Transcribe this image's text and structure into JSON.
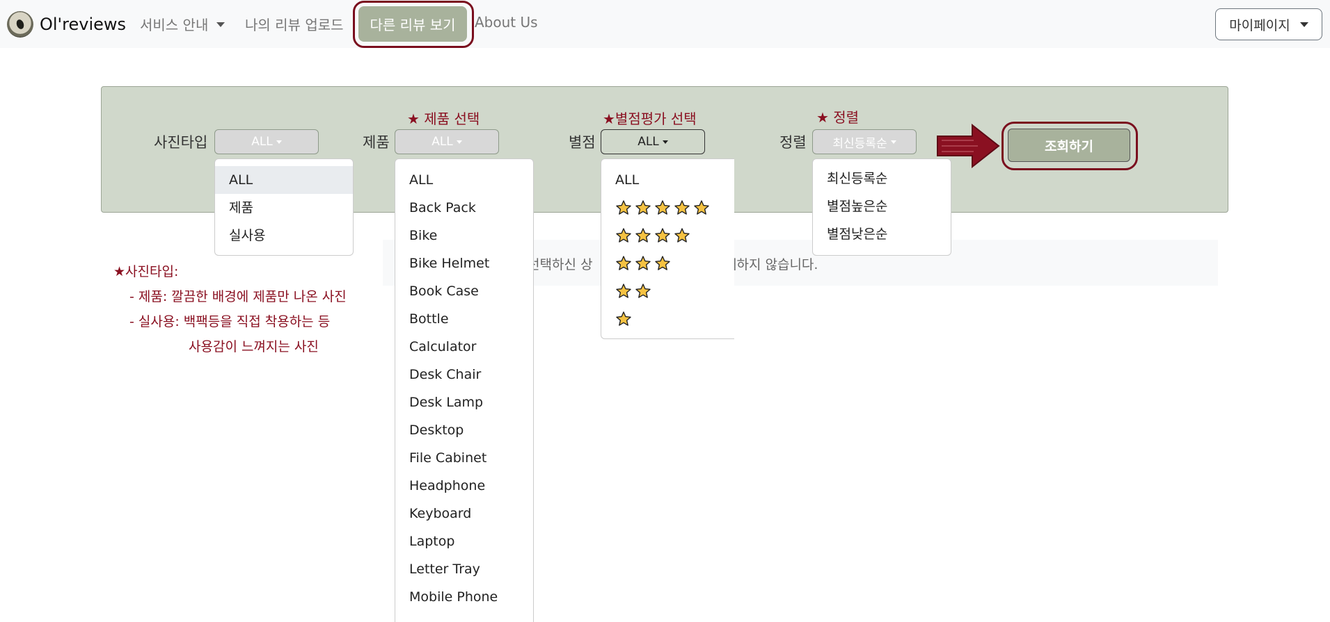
{
  "navbar": {
    "brand": "Ol'reviews",
    "service_guide": "서비스 안내",
    "upload_review": "나의 리뷰 업로드",
    "other_reviews": "다른 리뷰 보기",
    "about": "About Us",
    "mypage": "마이페이지"
  },
  "filters": {
    "photo_type_label": "사진타입",
    "product_label": "제품",
    "rating_label": "별점",
    "sort_label": "정렬",
    "photo_type_value": "ALL",
    "product_value": "ALL",
    "rating_value": "ALL",
    "sort_value": "최신등록순",
    "hint_product": "★ 제품 선택",
    "hint_rating": "★별점평가 선택",
    "hint_sort": "★ 정렬",
    "search_button": "조회하기"
  },
  "photo_type_options": [
    "ALL",
    "제품",
    "실사용"
  ],
  "product_options": [
    "ALL",
    "Back Pack",
    "Bike",
    "Bike Helmet",
    "Book Case",
    "Bottle",
    "Calculator",
    "Desk Chair",
    "Desk Lamp",
    "Desktop",
    "File Cabinet",
    "Headphone",
    "Keyboard",
    "Laptop",
    "Letter Tray",
    "Mobile Phone"
  ],
  "rating_options": {
    "all": "ALL",
    "star_rows": [
      5,
      4,
      3,
      2,
      1
    ]
  },
  "sort_options": [
    "최신등록순",
    "별점높은순",
    "별점낮은순"
  ],
  "no_result": {
    "left": "선택하신 상",
    "right": "재하지 않습니다."
  },
  "notes": {
    "title": "★사진타입:",
    "line1": "- 제품: 깔끔한 배경에 제품만 나온 사진",
    "line2": "- 실사용: 백팩등을 직접 착용하는 등",
    "line3": "사용감이 느껴지는 사진"
  },
  "colors": {
    "accent": "#a8b29c",
    "panel": "#d0d8cb",
    "highlight": "#7a0e1e",
    "star": "#f5c242"
  }
}
